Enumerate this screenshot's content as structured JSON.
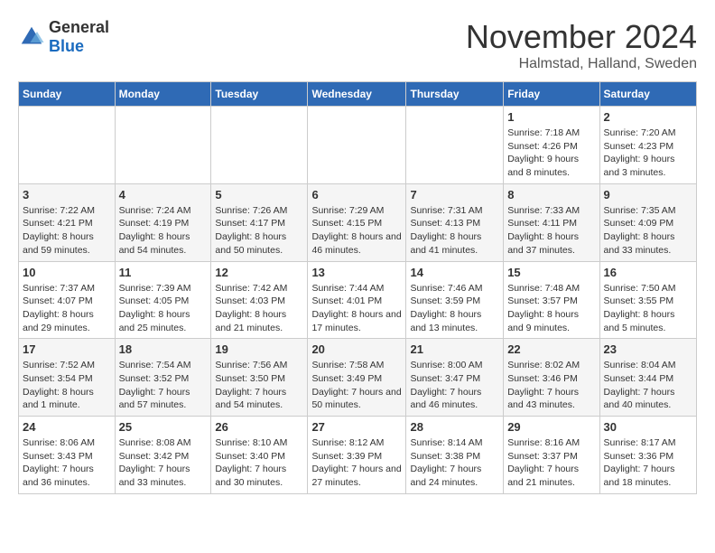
{
  "logo": {
    "general": "General",
    "blue": "Blue"
  },
  "header": {
    "month": "November 2024",
    "location": "Halmstad, Halland, Sweden"
  },
  "weekdays": [
    "Sunday",
    "Monday",
    "Tuesday",
    "Wednesday",
    "Thursday",
    "Friday",
    "Saturday"
  ],
  "weeks": [
    [
      {
        "day": "",
        "info": ""
      },
      {
        "day": "",
        "info": ""
      },
      {
        "day": "",
        "info": ""
      },
      {
        "day": "",
        "info": ""
      },
      {
        "day": "",
        "info": ""
      },
      {
        "day": "1",
        "info": "Sunrise: 7:18 AM\nSunset: 4:26 PM\nDaylight: 9 hours and 8 minutes."
      },
      {
        "day": "2",
        "info": "Sunrise: 7:20 AM\nSunset: 4:23 PM\nDaylight: 9 hours and 3 minutes."
      }
    ],
    [
      {
        "day": "3",
        "info": "Sunrise: 7:22 AM\nSunset: 4:21 PM\nDaylight: 8 hours and 59 minutes."
      },
      {
        "day": "4",
        "info": "Sunrise: 7:24 AM\nSunset: 4:19 PM\nDaylight: 8 hours and 54 minutes."
      },
      {
        "day": "5",
        "info": "Sunrise: 7:26 AM\nSunset: 4:17 PM\nDaylight: 8 hours and 50 minutes."
      },
      {
        "day": "6",
        "info": "Sunrise: 7:29 AM\nSunset: 4:15 PM\nDaylight: 8 hours and 46 minutes."
      },
      {
        "day": "7",
        "info": "Sunrise: 7:31 AM\nSunset: 4:13 PM\nDaylight: 8 hours and 41 minutes."
      },
      {
        "day": "8",
        "info": "Sunrise: 7:33 AM\nSunset: 4:11 PM\nDaylight: 8 hours and 37 minutes."
      },
      {
        "day": "9",
        "info": "Sunrise: 7:35 AM\nSunset: 4:09 PM\nDaylight: 8 hours and 33 minutes."
      }
    ],
    [
      {
        "day": "10",
        "info": "Sunrise: 7:37 AM\nSunset: 4:07 PM\nDaylight: 8 hours and 29 minutes."
      },
      {
        "day": "11",
        "info": "Sunrise: 7:39 AM\nSunset: 4:05 PM\nDaylight: 8 hours and 25 minutes."
      },
      {
        "day": "12",
        "info": "Sunrise: 7:42 AM\nSunset: 4:03 PM\nDaylight: 8 hours and 21 minutes."
      },
      {
        "day": "13",
        "info": "Sunrise: 7:44 AM\nSunset: 4:01 PM\nDaylight: 8 hours and 17 minutes."
      },
      {
        "day": "14",
        "info": "Sunrise: 7:46 AM\nSunset: 3:59 PM\nDaylight: 8 hours and 13 minutes."
      },
      {
        "day": "15",
        "info": "Sunrise: 7:48 AM\nSunset: 3:57 PM\nDaylight: 8 hours and 9 minutes."
      },
      {
        "day": "16",
        "info": "Sunrise: 7:50 AM\nSunset: 3:55 PM\nDaylight: 8 hours and 5 minutes."
      }
    ],
    [
      {
        "day": "17",
        "info": "Sunrise: 7:52 AM\nSunset: 3:54 PM\nDaylight: 8 hours and 1 minute."
      },
      {
        "day": "18",
        "info": "Sunrise: 7:54 AM\nSunset: 3:52 PM\nDaylight: 7 hours and 57 minutes."
      },
      {
        "day": "19",
        "info": "Sunrise: 7:56 AM\nSunset: 3:50 PM\nDaylight: 7 hours and 54 minutes."
      },
      {
        "day": "20",
        "info": "Sunrise: 7:58 AM\nSunset: 3:49 PM\nDaylight: 7 hours and 50 minutes."
      },
      {
        "day": "21",
        "info": "Sunrise: 8:00 AM\nSunset: 3:47 PM\nDaylight: 7 hours and 46 minutes."
      },
      {
        "day": "22",
        "info": "Sunrise: 8:02 AM\nSunset: 3:46 PM\nDaylight: 7 hours and 43 minutes."
      },
      {
        "day": "23",
        "info": "Sunrise: 8:04 AM\nSunset: 3:44 PM\nDaylight: 7 hours and 40 minutes."
      }
    ],
    [
      {
        "day": "24",
        "info": "Sunrise: 8:06 AM\nSunset: 3:43 PM\nDaylight: 7 hours and 36 minutes."
      },
      {
        "day": "25",
        "info": "Sunrise: 8:08 AM\nSunset: 3:42 PM\nDaylight: 7 hours and 33 minutes."
      },
      {
        "day": "26",
        "info": "Sunrise: 8:10 AM\nSunset: 3:40 PM\nDaylight: 7 hours and 30 minutes."
      },
      {
        "day": "27",
        "info": "Sunrise: 8:12 AM\nSunset: 3:39 PM\nDaylight: 7 hours and 27 minutes."
      },
      {
        "day": "28",
        "info": "Sunrise: 8:14 AM\nSunset: 3:38 PM\nDaylight: 7 hours and 24 minutes."
      },
      {
        "day": "29",
        "info": "Sunrise: 8:16 AM\nSunset: 3:37 PM\nDaylight: 7 hours and 21 minutes."
      },
      {
        "day": "30",
        "info": "Sunrise: 8:17 AM\nSunset: 3:36 PM\nDaylight: 7 hours and 18 minutes."
      }
    ]
  ]
}
